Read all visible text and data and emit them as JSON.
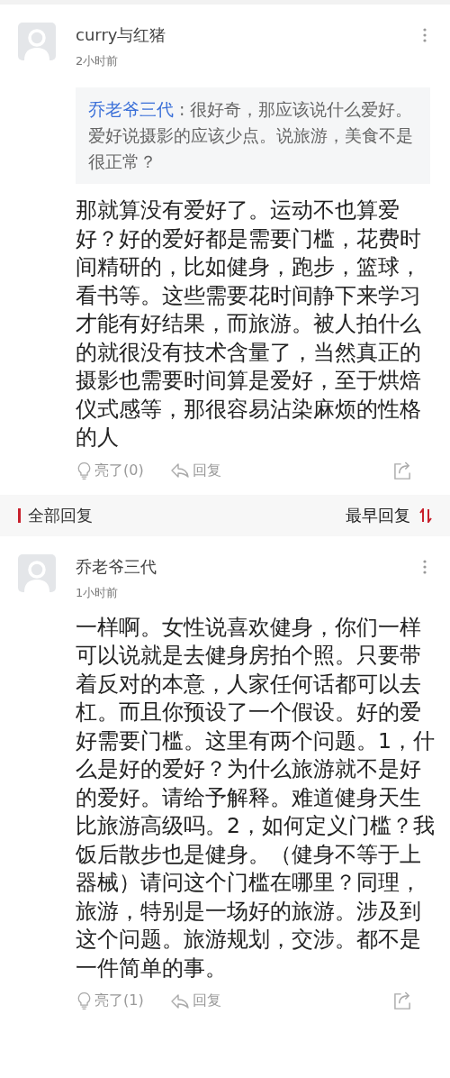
{
  "comments": [
    {
      "author": "curry与红猪",
      "time": "2小时前",
      "quote": {
        "author": "乔老爷三代",
        "separator": ":",
        "text": "很好奇，那应该说什么爱好。爱好说摄影的应该少点。说旅游，美食不是很正常？"
      },
      "body": "那就算没有爱好了。运动不也算爱好？好的爱好都是需要门槛，花费时间精研的，比如健身，跑步，篮球，看书等。这些需要花时间静下来学习才能有好结果，而旅游。被人拍什么的就很没有技术含量了，当然真正的摄影也需要时间算是爱好，至于烘焙仪式感等，那很容易沾染麻烦的性格的人",
      "like": "亮了(0)",
      "reply": "回复"
    }
  ],
  "section": {
    "title": "全部回复",
    "sort": "最早回复"
  },
  "replies": [
    {
      "author": "乔老爷三代",
      "time": "1小时前",
      "body": "一样啊。女性说喜欢健身，你们一样可以说就是去健身房拍个照。只要带着反对的本意，人家任何话都可以去杠。而且你预设了一个假设。好的爱好需要门槛。这里有两个问题。1，什么是好的爱好？为什么旅游就不是好的爱好。请给予解释。难道健身天生比旅游高级吗。2，如何定义门槛？我饭后散步也是健身。（健身不等于上器械）请问这个门槛在哪里？同理，旅游，特别是一场好的旅游。涉及到这个问题。旅游规划，交涉。都不是一件简单的事。",
      "like": "亮了(1)",
      "reply": "回复"
    }
  ]
}
